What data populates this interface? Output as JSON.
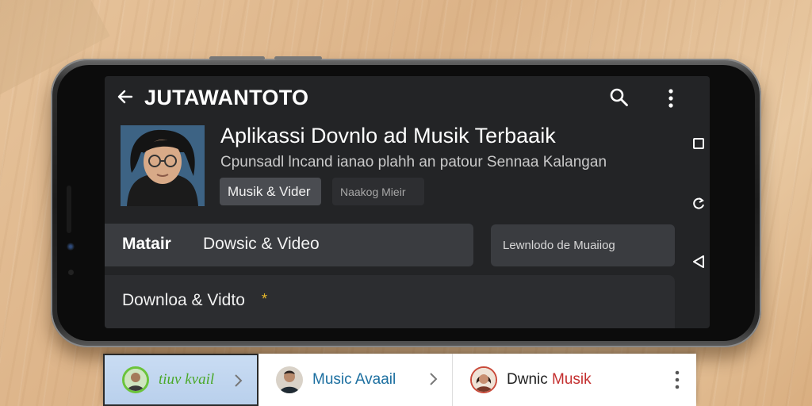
{
  "app": {
    "title": "JUTAWANTOTO"
  },
  "hero": {
    "title": "Aplikassi Dovnlo ad Musik Terbaaik",
    "subtitle": "Cpunsadl lncand ianao plahh an patour Sennaa Kalangan",
    "chips": [
      "Musik & Vider",
      "Naakog Mieir"
    ]
  },
  "tabs": {
    "active": "Matair",
    "second": "Dowsic & Video"
  },
  "side_card": {
    "label": "Lewnlodo de Muaiiog"
  },
  "download_row": {
    "label": "Downloa & Vidto",
    "star": "*"
  },
  "bottom_strip": {
    "items": [
      {
        "label": "tiuv kvail"
      },
      {
        "label": "Music Avaail"
      },
      {
        "label_prefix": "Dwnic ",
        "label_accent": "Musik"
      }
    ]
  },
  "icons": [
    "back-arrow-icon",
    "search-icon",
    "more-vert-icon",
    "square-icon",
    "refresh-icon",
    "triangle-back-icon",
    "chevron-right-icon",
    "star-icon"
  ],
  "colors": {
    "screen_bg": "#232426",
    "row_bg": "#3a3c40",
    "star": "#e8b92a",
    "accent_green": "#4aa828",
    "accent_blue": "#1c6fa0",
    "accent_red": "#c42f2f"
  }
}
